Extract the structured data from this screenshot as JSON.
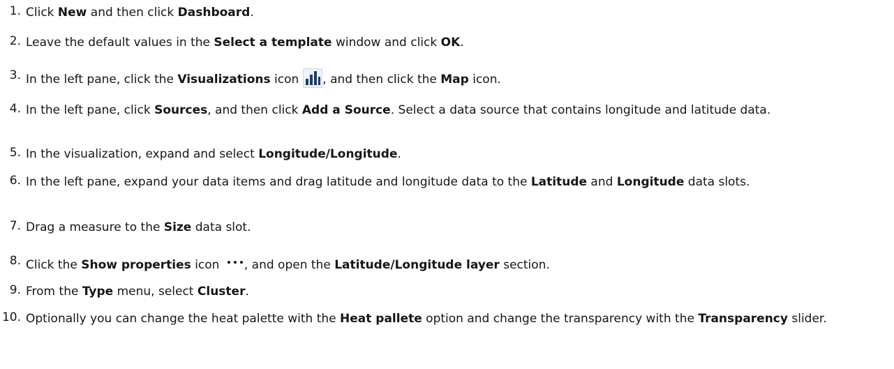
{
  "steps": [
    {
      "num": "1.",
      "parts": [
        {
          "t": "Click "
        },
        {
          "b": "New"
        },
        {
          "t": " and then click "
        },
        {
          "b": "Dashboard"
        },
        {
          "t": "."
        }
      ]
    },
    {
      "num": "2.",
      "parts": [
        {
          "t": "Leave the default values in the "
        },
        {
          "b": "Select a template"
        },
        {
          "t": " window and click "
        },
        {
          "b": "OK"
        },
        {
          "t": "."
        }
      ]
    },
    {
      "num": "3.",
      "parts": [
        {
          "t": "In the left pane, click the "
        },
        {
          "b": "Visualizations"
        },
        {
          "t": " icon"
        },
        {
          "icon": "visualizations-icon"
        },
        {
          "t": ", and then click the "
        },
        {
          "b": "Map"
        },
        {
          "t": " icon."
        }
      ]
    },
    {
      "num": "4.",
      "parts": [
        {
          "t": "In the left pane, click "
        },
        {
          "b": "Sources"
        },
        {
          "t": ", and then click "
        },
        {
          "b": "Add a Source"
        },
        {
          "t": ". Select a data source that contains longitude and latitude data."
        }
      ]
    },
    {
      "num": "5.",
      "parts": [
        {
          "t": "In the visualization, expand and select "
        },
        {
          "b": "Longitude/Longitude"
        },
        {
          "t": "."
        }
      ]
    },
    {
      "num": "6.",
      "parts": [
        {
          "t": "In the left pane, expand your data items and drag latitude and longitude data to the "
        },
        {
          "b": "Latitude"
        },
        {
          "t": " and "
        },
        {
          "b": "Longitude"
        },
        {
          "t": " data slots."
        }
      ]
    },
    {
      "num": "7.",
      "parts": [
        {
          "t": "Drag a measure to the "
        },
        {
          "b": "Size"
        },
        {
          "t": " data slot."
        }
      ]
    },
    {
      "num": "8.",
      "parts": [
        {
          "t": "Click the "
        },
        {
          "b": "Show properties"
        },
        {
          "t": " icon "
        },
        {
          "icon": "show-properties-icon"
        },
        {
          "t": ", and open the "
        },
        {
          "b": "Latitude/Longitude layer"
        },
        {
          "t": " section."
        }
      ]
    },
    {
      "num": "9.",
      "parts": [
        {
          "t": "From the "
        },
        {
          "b": "Type"
        },
        {
          "t": " menu, select "
        },
        {
          "b": "Cluster"
        },
        {
          "t": "."
        }
      ]
    },
    {
      "num": "10.",
      "parts": [
        {
          "t": "Optionally you can change the heat palette with the "
        },
        {
          "b": "Heat pallete"
        },
        {
          "t": " option and change the transparency with the "
        },
        {
          "b": "Transparency"
        },
        {
          "t": " slider."
        }
      ]
    }
  ],
  "colors": {
    "text": "#161616",
    "icon_bars": "#1f3a68"
  }
}
